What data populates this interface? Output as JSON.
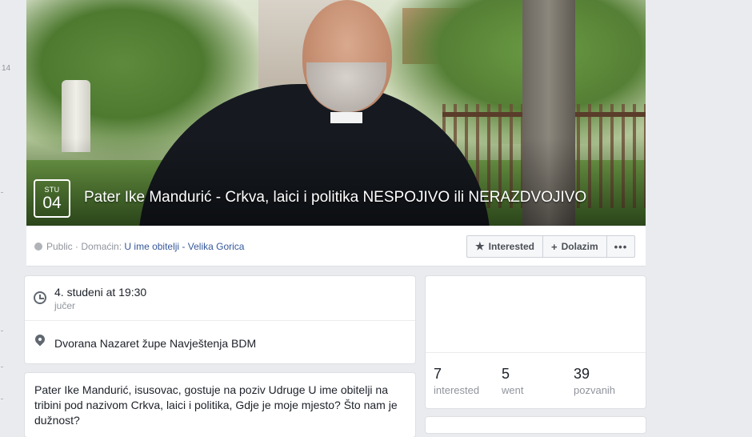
{
  "left_rail": {
    "number": "14"
  },
  "event": {
    "date_month": "STU",
    "date_day": "04",
    "title": "Pater Ike Mandurić - Crkva, laici i politika NESPOJIVO ili NERAZDVOJIVO"
  },
  "meta": {
    "privacy": "Public",
    "separator": "·",
    "host_label": "Domaćin:",
    "host_name": "U ime obitelji - Velika Gorica"
  },
  "actions": {
    "interested_icon": "star-icon",
    "interested_label": "Interested",
    "going_icon": "plus-icon",
    "going_label": "Dolazim",
    "more_label": "•••"
  },
  "details": {
    "time_main": "4. studeni at 19:30",
    "time_sub": "jučer",
    "place": "Dvorana Nazaret župe Navještenja BDM"
  },
  "description": {
    "text": "Pater Ike Mandurić, isusovac, gostuje na poziv Udruge U ime obitelji na tribini pod nazivom Crkva, laici i politika, Gdje je moje mjesto? Što nam je dužnost?"
  },
  "stats": [
    {
      "count": "7",
      "label": "interested"
    },
    {
      "count": "5",
      "label": "went"
    },
    {
      "count": "39",
      "label": "pozvanih"
    }
  ],
  "colors": {
    "page_bg": "#e9ebee",
    "link": "#365899",
    "muted": "#90949c"
  }
}
